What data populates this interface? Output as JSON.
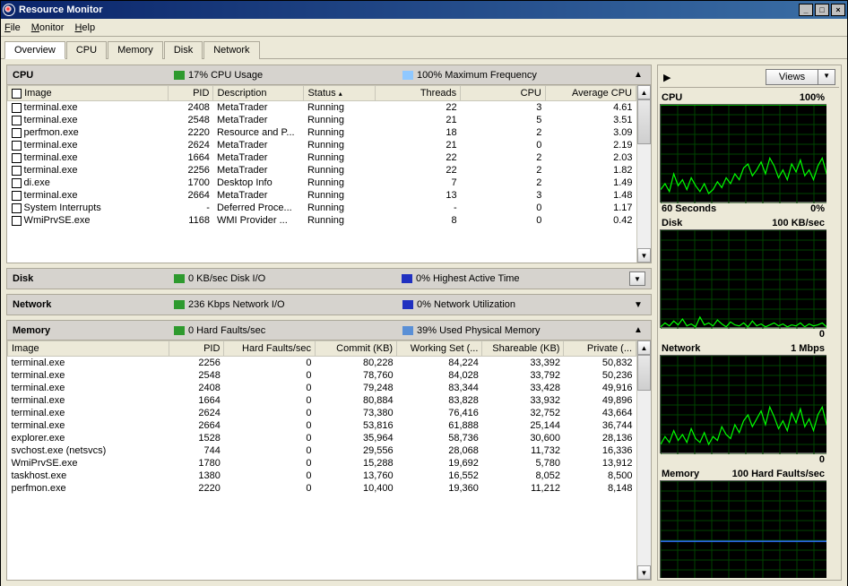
{
  "window": {
    "title": "Resource Monitor",
    "buttons": {
      "min": "_",
      "max": "□",
      "close": "×"
    }
  },
  "menu": {
    "file": "File",
    "monitor": "Monitor",
    "help": "Help"
  },
  "tabs": [
    "Overview",
    "CPU",
    "Memory",
    "Disk",
    "Network"
  ],
  "active_tab": 0,
  "cpu_panel": {
    "title": "CPU",
    "stat1": "17% CPU Usage",
    "stat2": "100% Maximum Frequency",
    "color1": "#2e9a2e",
    "color2": "#8fc8ff",
    "columns": [
      "Image",
      "PID",
      "Description",
      "Status",
      "Threads",
      "CPU",
      "Average CPU"
    ],
    "rows": [
      [
        "terminal.exe",
        "2408",
        "MetaTrader",
        "Running",
        "22",
        "3",
        "4.61"
      ],
      [
        "terminal.exe",
        "2548",
        "MetaTrader",
        "Running",
        "21",
        "5",
        "3.51"
      ],
      [
        "perfmon.exe",
        "2220",
        "Resource and P...",
        "Running",
        "18",
        "2",
        "3.09"
      ],
      [
        "terminal.exe",
        "2624",
        "MetaTrader",
        "Running",
        "21",
        "0",
        "2.19"
      ],
      [
        "terminal.exe",
        "1664",
        "MetaTrader",
        "Running",
        "22",
        "2",
        "2.03"
      ],
      [
        "terminal.exe",
        "2256",
        "MetaTrader",
        "Running",
        "22",
        "2",
        "1.82"
      ],
      [
        "di.exe",
        "1700",
        "Desktop Info",
        "Running",
        "7",
        "2",
        "1.49"
      ],
      [
        "terminal.exe",
        "2664",
        "MetaTrader",
        "Running",
        "13",
        "3",
        "1.48"
      ],
      [
        "System Interrupts",
        "-",
        "Deferred Proce...",
        "Running",
        "-",
        "0",
        "1.17"
      ],
      [
        "WmiPrvSE.exe",
        "1168",
        "WMI Provider ...",
        "Running",
        "8",
        "0",
        "0.42"
      ]
    ]
  },
  "disk_panel": {
    "title": "Disk",
    "stat1": "0 KB/sec Disk I/O",
    "stat2": "0% Highest Active Time",
    "color1": "#2e9a2e",
    "color2": "#2030c0"
  },
  "net_panel": {
    "title": "Network",
    "stat1": "236 Kbps Network I/O",
    "stat2": "0% Network Utilization",
    "color1": "#2e9a2e",
    "color2": "#2030c0"
  },
  "mem_panel": {
    "title": "Memory",
    "stat1": "0 Hard Faults/sec",
    "stat2": "39% Used Physical Memory",
    "color1": "#2e9a2e",
    "color2": "#5a8fd6",
    "columns": [
      "Image",
      "PID",
      "Hard Faults/sec",
      "Commit (KB)",
      "Working Set (...",
      "Shareable (KB)",
      "Private (..."
    ],
    "rows": [
      [
        "terminal.exe",
        "2256",
        "0",
        "80,228",
        "84,224",
        "33,392",
        "50,832"
      ],
      [
        "terminal.exe",
        "2548",
        "0",
        "78,760",
        "84,028",
        "33,792",
        "50,236"
      ],
      [
        "terminal.exe",
        "2408",
        "0",
        "79,248",
        "83,344",
        "33,428",
        "49,916"
      ],
      [
        "terminal.exe",
        "1664",
        "0",
        "80,884",
        "83,828",
        "33,932",
        "49,896"
      ],
      [
        "terminal.exe",
        "2624",
        "0",
        "73,380",
        "76,416",
        "32,752",
        "43,664"
      ],
      [
        "terminal.exe",
        "2664",
        "0",
        "53,816",
        "61,888",
        "25,144",
        "36,744"
      ],
      [
        "explorer.exe",
        "1528",
        "0",
        "35,964",
        "58,736",
        "30,600",
        "28,136"
      ],
      [
        "svchost.exe (netsvcs)",
        "744",
        "0",
        "29,556",
        "28,068",
        "11,732",
        "16,336"
      ],
      [
        "WmiPrvSE.exe",
        "1780",
        "0",
        "15,288",
        "19,692",
        "5,780",
        "13,912"
      ],
      [
        "taskhost.exe",
        "1380",
        "0",
        "13,760",
        "16,552",
        "8,052",
        "8,500"
      ],
      [
        "perfmon.exe",
        "2220",
        "0",
        "10,400",
        "19,360",
        "11,212",
        "8,148"
      ]
    ]
  },
  "right": {
    "views": "Views",
    "graphs": [
      {
        "title": "CPU",
        "right": "100%",
        "foot_left": "60 Seconds",
        "foot_right": "0%"
      },
      {
        "title": "Disk",
        "right": "100 KB/sec",
        "foot_right": "0"
      },
      {
        "title": "Network",
        "right": "1 Mbps",
        "foot_right": "0"
      },
      {
        "title": "Memory",
        "right": "100 Hard Faults/sec",
        "foot_right": "0"
      }
    ]
  },
  "chart_data": [
    {
      "type": "line",
      "title": "CPU",
      "ylabel": "%",
      "ylim": [
        0,
        100
      ],
      "x_seconds": 60,
      "series": [
        {
          "name": "CPU Usage",
          "values": [
            14,
            20,
            12,
            30,
            18,
            24,
            14,
            26,
            18,
            12,
            20,
            10,
            14,
            22,
            16,
            26,
            20,
            30,
            24,
            36,
            40,
            28,
            34,
            42,
            30,
            46,
            38,
            26,
            34,
            24,
            40,
            32,
            44,
            28,
            34,
            24,
            38,
            46,
            30,
            22
          ]
        },
        {
          "name": "Max Frequency",
          "values": [
            100,
            100,
            100,
            100,
            100,
            100,
            100,
            100,
            100,
            100,
            100,
            100,
            100,
            100,
            100,
            100,
            100,
            100,
            100,
            100,
            100,
            100,
            100,
            100,
            100,
            100,
            100,
            100,
            100,
            100,
            100,
            100,
            100,
            100,
            100,
            100,
            100,
            100,
            100,
            100
          ]
        }
      ]
    },
    {
      "type": "line",
      "title": "Disk",
      "ylabel": "KB/sec",
      "ylim": [
        0,
        100
      ],
      "x_seconds": 60,
      "series": [
        {
          "name": "Disk I/O",
          "values": [
            2,
            6,
            3,
            8,
            4,
            10,
            3,
            5,
            2,
            12,
            4,
            6,
            3,
            9,
            5,
            2,
            7,
            4,
            3,
            6,
            2,
            8,
            3,
            5,
            2,
            4,
            6,
            3,
            5,
            2,
            4,
            3,
            6,
            2,
            5,
            3,
            4,
            6,
            2,
            3
          ]
        }
      ]
    },
    {
      "type": "line",
      "title": "Network",
      "ylabel": "Mbps",
      "ylim": [
        0,
        1
      ],
      "x_seconds": 60,
      "series": [
        {
          "name": "Network I/O",
          "values": [
            0.1,
            0.18,
            0.12,
            0.24,
            0.14,
            0.2,
            0.12,
            0.26,
            0.16,
            0.12,
            0.22,
            0.1,
            0.18,
            0.14,
            0.28,
            0.2,
            0.16,
            0.3,
            0.22,
            0.34,
            0.4,
            0.28,
            0.36,
            0.44,
            0.3,
            0.48,
            0.38,
            0.26,
            0.34,
            0.24,
            0.42,
            0.32,
            0.46,
            0.28,
            0.36,
            0.24,
            0.4,
            0.48,
            0.3,
            0.22
          ]
        }
      ]
    },
    {
      "type": "line",
      "title": "Memory",
      "ylabel": "Hard Faults/sec",
      "ylim": [
        0,
        100
      ],
      "x_seconds": 60,
      "series": [
        {
          "name": "Hard Faults",
          "values": [
            0,
            0,
            0,
            0,
            0,
            0,
            0,
            0,
            0,
            0,
            0,
            0,
            0,
            0,
            0,
            0,
            0,
            0,
            0,
            0,
            0,
            0,
            0,
            0,
            0,
            0,
            0,
            0,
            0,
            0,
            0,
            0,
            0,
            0,
            0,
            0,
            0,
            0,
            0,
            0
          ]
        },
        {
          "name": "Used Physical Memory %",
          "values": [
            39,
            39,
            39,
            39,
            39,
            39,
            39,
            39,
            39,
            39,
            39,
            39,
            39,
            39,
            39,
            39,
            39,
            39,
            39,
            39,
            39,
            39,
            39,
            39,
            39,
            39,
            39,
            39,
            39,
            39,
            39,
            39,
            39,
            39,
            39,
            39,
            39,
            39,
            39,
            39
          ]
        }
      ]
    }
  ]
}
